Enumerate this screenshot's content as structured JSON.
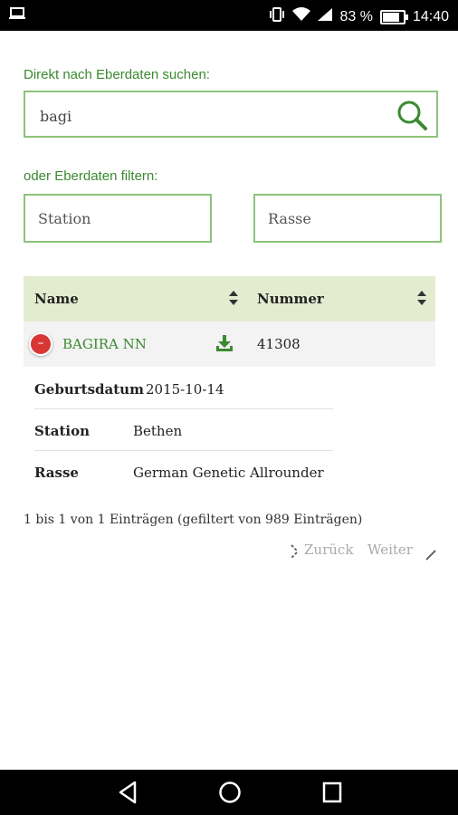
{
  "status_bar": {
    "battery": "83 %",
    "time": "14:40",
    "battery_fraction": 0.83
  },
  "search": {
    "label": "Direkt nach Eberdaten suchen:",
    "value": "bagi"
  },
  "filters": {
    "label": "oder Eberdaten filtern:",
    "station_placeholder": "Station",
    "rasse_placeholder": "Rasse"
  },
  "table": {
    "headers": {
      "name": "Name",
      "nummer": "Nummer"
    },
    "row": {
      "name": "BAGIRA NN",
      "nummer": "41308",
      "collapse_symbol": "–"
    },
    "details": [
      {
        "key": "Geburtsdatum",
        "value": "2015-10-14"
      },
      {
        "key": "Station",
        "value": "Bethen"
      },
      {
        "key": "Rasse",
        "value": "German Genetic Allrounder"
      }
    ]
  },
  "pagination": {
    "info": "1 bis 1 von 1 Einträgen (gefiltert von 989 Einträgen)",
    "prev": "Zurück",
    "next": "Weiter"
  },
  "colors": {
    "accent": "#3a8a2f",
    "border": "#8dc37b",
    "header_bg": "#e4ecd0",
    "remove": "#d93636"
  }
}
